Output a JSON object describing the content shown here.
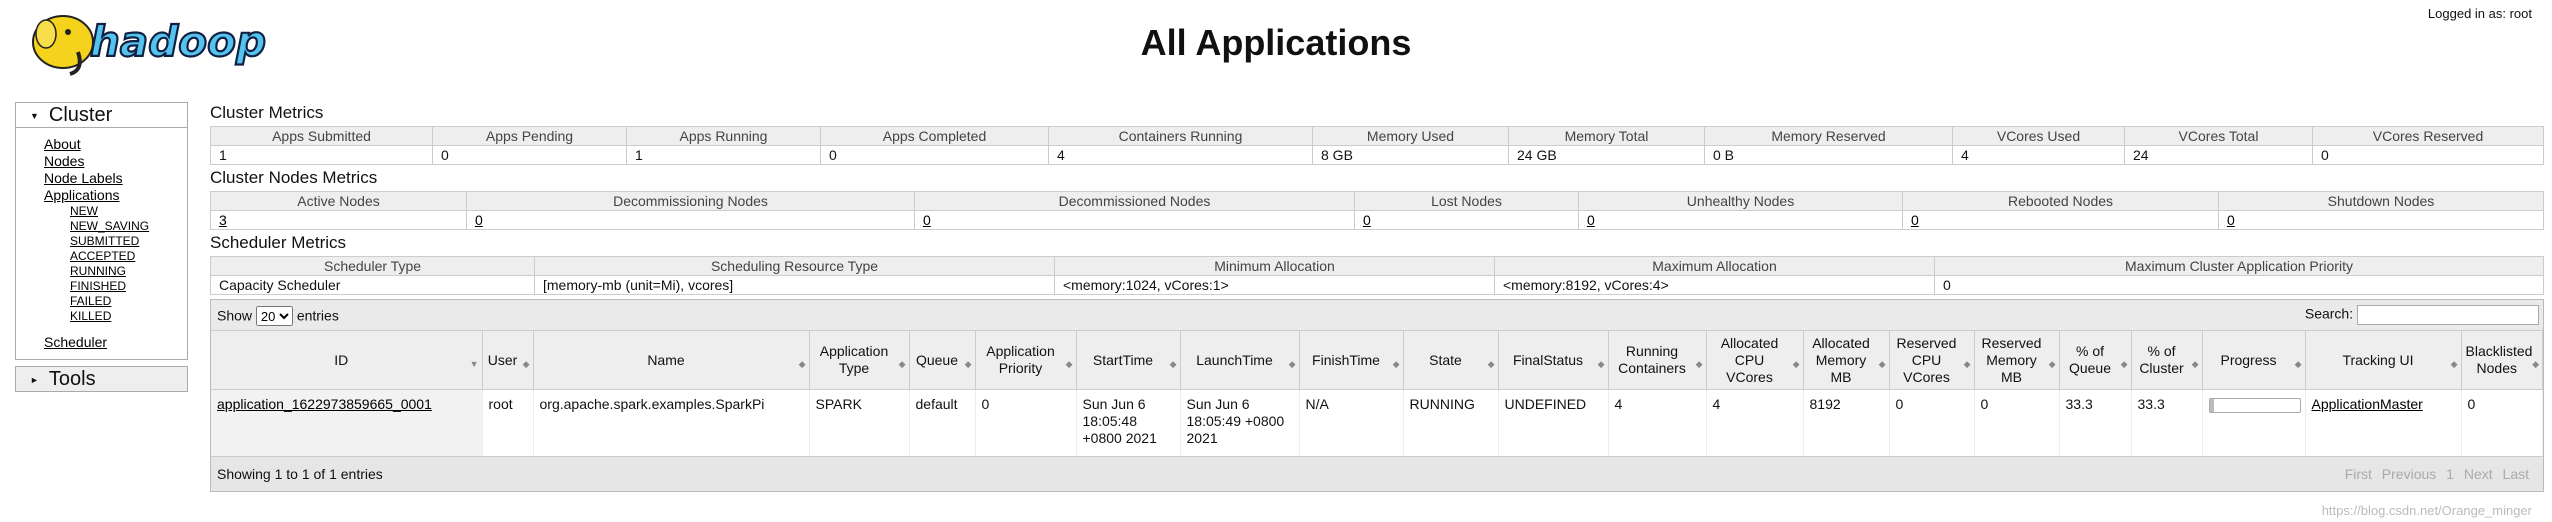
{
  "header": {
    "logo_text": "hadoop",
    "title": "All Applications",
    "login": "Logged in as: root"
  },
  "sidebar": {
    "cluster_label": "Cluster",
    "links": [
      "About",
      "Nodes",
      "Node Labels",
      "Applications"
    ],
    "app_states": [
      "NEW",
      "NEW_SAVING",
      "SUBMITTED",
      "ACCEPTED",
      "RUNNING",
      "FINISHED",
      "FAILED",
      "KILLED"
    ],
    "scheduler_link": "Scheduler",
    "tools_label": "Tools"
  },
  "cluster_metrics": {
    "title": "Cluster Metrics",
    "headers": [
      "Apps Submitted",
      "Apps Pending",
      "Apps Running",
      "Apps Completed",
      "Containers Running",
      "Memory Used",
      "Memory Total",
      "Memory Reserved",
      "VCores Used",
      "VCores Total",
      "VCores Reserved"
    ],
    "values": [
      "1",
      "0",
      "1",
      "0",
      "4",
      "8 GB",
      "24 GB",
      "0 B",
      "4",
      "24",
      "0"
    ]
  },
  "node_metrics": {
    "title": "Cluster Nodes Metrics",
    "headers": [
      "Active Nodes",
      "Decommissioning Nodes",
      "Decommissioned Nodes",
      "Lost Nodes",
      "Unhealthy Nodes",
      "Rebooted Nodes",
      "Shutdown Nodes"
    ],
    "values": [
      "3",
      "0",
      "0",
      "0",
      "0",
      "0",
      "0"
    ]
  },
  "scheduler_metrics": {
    "title": "Scheduler Metrics",
    "headers": [
      "Scheduler Type",
      "Scheduling Resource Type",
      "Minimum Allocation",
      "Maximum Allocation",
      "Maximum Cluster Application Priority"
    ],
    "values": [
      "Capacity Scheduler",
      "[memory-mb (unit=Mi), vcores]",
      "<memory:1024, vCores:1>",
      "<memory:8192, vCores:4>",
      "0"
    ]
  },
  "apps_table": {
    "show_label": "Show",
    "page_size": "20",
    "entries_label": "entries",
    "search_label": "Search:",
    "columns": [
      "ID",
      "User",
      "Name",
      "Application Type",
      "Queue",
      "Application Priority",
      "StartTime",
      "LaunchTime",
      "FinishTime",
      "State",
      "FinalStatus",
      "Running Containers",
      "Allocated CPU VCores",
      "Allocated Memory MB",
      "Reserved CPU VCores",
      "Reserved Memory MB",
      "% of Queue",
      "% of Cluster",
      "Progress",
      "Tracking UI",
      "Blacklisted Nodes"
    ],
    "row": {
      "id": "application_1622973859665_0001",
      "user": "root",
      "name": "org.apache.spark.examples.SparkPi",
      "type": "SPARK",
      "queue": "default",
      "priority": "0",
      "start_time": "Sun Jun 6 18:05:48 +0800 2021",
      "launch_time": "Sun Jun 6 18:05:49 +0800 2021",
      "finish_time": "N/A",
      "state": "RUNNING",
      "final_status": "UNDEFINED",
      "running_containers": "4",
      "alloc_vcores": "4",
      "alloc_memory": "8192",
      "reserved_vcores": "0",
      "reserved_memory": "0",
      "pct_queue": "33.3",
      "pct_cluster": "33.3",
      "progress_fraction": 0.05,
      "tracking_ui": "ApplicationMaster",
      "blacklisted": "0"
    },
    "showing": "Showing 1 to 1 of 1 entries",
    "pager": [
      "First",
      "Previous",
      "1",
      "Next",
      "Last"
    ]
  },
  "watermark": "https://blog.csdn.net/Orange_minger",
  "colors": {
    "header_bg": "#eeeeee",
    "border": "#cccccc"
  }
}
